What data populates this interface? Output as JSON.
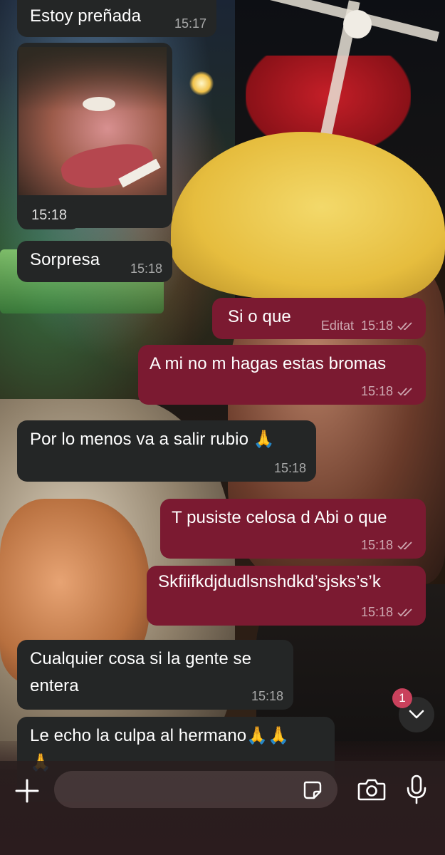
{
  "messages": [
    {
      "dir": "in",
      "text": "Estoy preñada",
      "time": "15:17"
    },
    {
      "dir": "in",
      "type": "media",
      "time": "15:18"
    },
    {
      "dir": "in",
      "text": "Sorpresa",
      "time": "15:18"
    },
    {
      "dir": "out",
      "text": "Si o que",
      "time": "15:18",
      "edited": "Editat",
      "read": true
    },
    {
      "dir": "out",
      "text": "A mi no m hagas estas bromas",
      "time": "15:18",
      "read": true
    },
    {
      "dir": "in",
      "text": "Por lo menos va a salir rubio 🙏",
      "time": "15:18"
    },
    {
      "dir": "out",
      "text": "T pusiste celosa d Abi o que",
      "time": "15:18",
      "read": true
    },
    {
      "dir": "out",
      "text": "Skfiifkdjdudlsnshdkd’sjsks’s’k",
      "time": "15:18",
      "read": true
    },
    {
      "dir": "in",
      "text_lines": [
        "Cualquier cosa si la gente se",
        "entera"
      ],
      "time": "15:18"
    },
    {
      "dir": "in",
      "text_lines": [
        "Le echo la culpa al hermano🙏🙏",
        "🙏"
      ]
    }
  ],
  "scroll": {
    "unread_count": "1",
    "icon": "chevron-down-icon"
  },
  "composer": {
    "placeholder": "",
    "icons": [
      "plus-icon",
      "sticker-icon",
      "camera-icon",
      "microphone-icon"
    ]
  },
  "colors": {
    "incoming_bubble": "#242626",
    "outgoing_bubble": "#7b1a31",
    "badge": "#c9415c"
  }
}
